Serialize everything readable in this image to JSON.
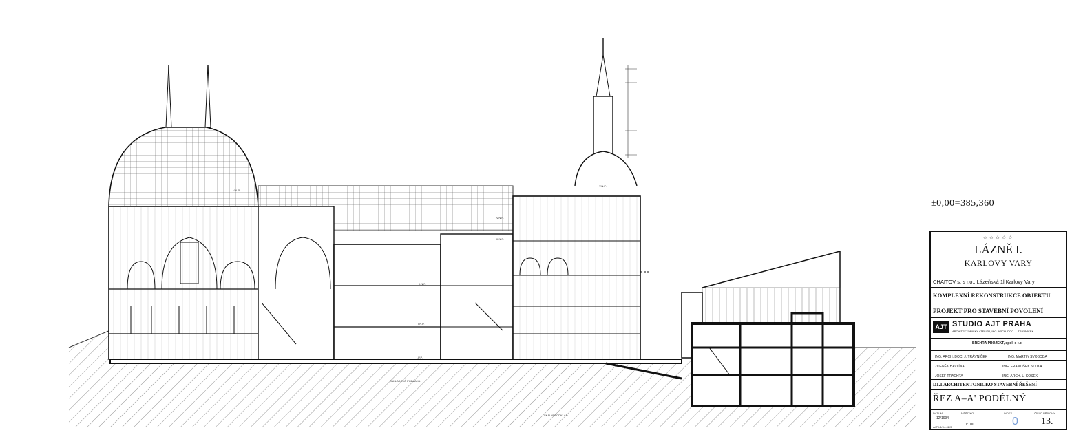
{
  "elevation_reference": "±0,00=385,360",
  "floor_labels": [
    "V.N.P.",
    "V.N.P.",
    "V.N.P.",
    "III.N.P.",
    "II.N.P.",
    "I.N.P.",
    "I.P.P."
  ],
  "notes": {
    "foundation_note": "ZÁKLADOVÁ PODLAHA",
    "rock_note": "SKALNÍ PODKLAD"
  },
  "title_block": {
    "stars": "☆☆☆☆☆",
    "building_name": "LÁZNĚ I.",
    "city": "KARLOVY VARY",
    "investor": "CHAITOV s. s r.o., Lázeňská 1l Karlovy Vary",
    "project": "KOMPLEXNÍ REKONSTRUKCE OBJEKTU",
    "stage": "PROJEKT PRO STAVEBNÍ POVOLENÍ",
    "studio": "STUDIO AJT PRAHA",
    "studio_detail": "ARCHITEKTONICKÝ ATELIÉR, ING. ARCH. DOC. J. TRÁVNÍČEK",
    "partner": "BREHRA PROJEKT, spol. s r.o.",
    "chief_architect": "ING. ARCH. DOC. J. TRÁVNÍČEK",
    "atelier_head": "ING. MARTIN SVOBODA",
    "project_lead": "ZDENĚK HAVLÍNA",
    "responsible_designer": "ING. FRANTIŠEK SOJKA",
    "drawn_by": "JOSEF TRACHTA",
    "checked_by": "ING. ARCH. L. KOŠEK",
    "part": "D1.1  ARCHITEKTONICKO STAVEBNÍ ŘEŠENÍ",
    "drawing_title": "ŘEZ A–A' PODÉLNÝ",
    "date_label": "DATUM",
    "date": "12/1994",
    "scale_label": "MĚŘÍTKO",
    "scale": "1:100",
    "index_label": "INDEX",
    "index": "0",
    "sheet_label": "ČÍSLO PŘÍLOHY",
    "sheet": "13.",
    "code": "AJT-L1/94-02/3"
  }
}
